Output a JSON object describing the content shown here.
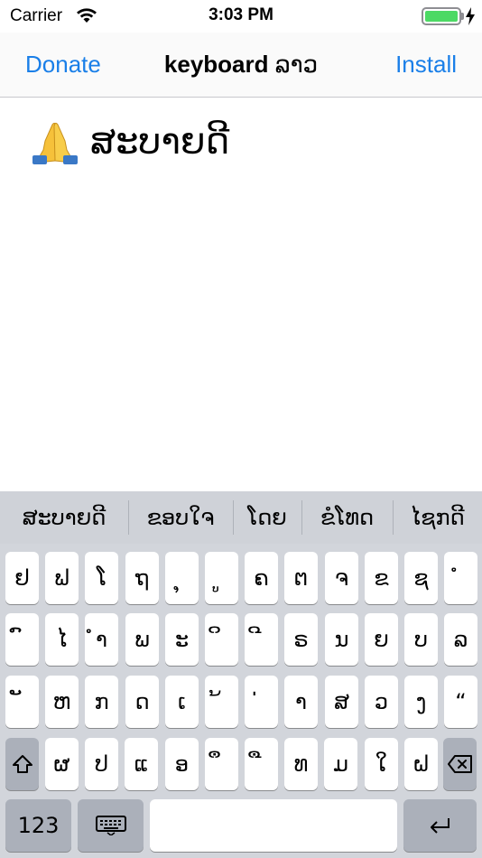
{
  "status": {
    "carrier": "Carrier",
    "time": "3:03 PM",
    "battery_level": 1.0,
    "battery_color": "#4cd964"
  },
  "nav": {
    "left_button": "Donate",
    "title_bold": "keyboard",
    "title_rest": " ລາວ",
    "right_button": "Install",
    "accent": "#1a7fe8"
  },
  "content": {
    "icon": "folded-hands-icon",
    "text": "ສະບາຍດີ"
  },
  "keyboard": {
    "suggestions": [
      "ສະບາຍດີ",
      "ຂອບໃຈ",
      "ໂດຍ",
      "ຂໍໂທດ",
      "ໄຊກດີ"
    ],
    "rows": [
      [
        "ຢ",
        "ຟ",
        "ໂ",
        "ຖ",
        "ຸ",
        "ູ",
        "ຄ",
        "ຕ",
        "ຈ",
        "ຂ",
        "ຊ",
        "ໍ"
      ],
      [
        "ົ",
        "ໄ",
        "ຳ",
        "ພ",
        "ະ",
        "ິ",
        "ີ",
        "ຣ",
        "ນ",
        "ຍ",
        "ບ",
        "ລ"
      ],
      [
        "ັ",
        "ຫ",
        "ກ",
        "ດ",
        "ເ",
        "້",
        "່",
        "າ",
        "ສ",
        "ວ",
        "ງ",
        "“"
      ],
      [
        "ຜ",
        "ປ",
        "ແ",
        "ອ",
        "ຶ",
        "ື",
        "ທ",
        "ມ",
        "ໃ",
        "ຝ"
      ]
    ],
    "numbers_label": "123",
    "shift_icon": "shift-icon",
    "backspace_icon": "backspace-icon",
    "globe_icon": "keyboard-icon",
    "return_icon": "return-icon"
  }
}
